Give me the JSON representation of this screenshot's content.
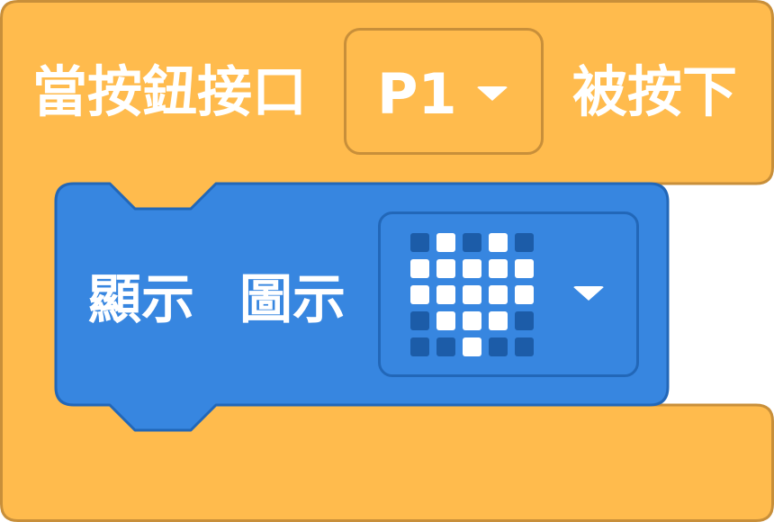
{
  "event_block": {
    "prefix_label": "當按鈕接口",
    "pin_value": "P1",
    "suffix_label": "被按下",
    "color": "#ffbb4d",
    "border_color": "#c88f3a"
  },
  "show_block": {
    "action_label": "顯示",
    "param_label": "圖示",
    "color": "#3786e0",
    "border_color": "#2267b8",
    "icon": "heart",
    "led_matrix": [
      [
        0,
        1,
        0,
        1,
        0
      ],
      [
        1,
        1,
        1,
        1,
        1
      ],
      [
        1,
        1,
        1,
        1,
        1
      ],
      [
        0,
        1,
        1,
        1,
        0
      ],
      [
        0,
        0,
        1,
        0,
        0
      ]
    ],
    "led_on_color": "#ffffff",
    "led_off_color": "#1c5ca8"
  }
}
